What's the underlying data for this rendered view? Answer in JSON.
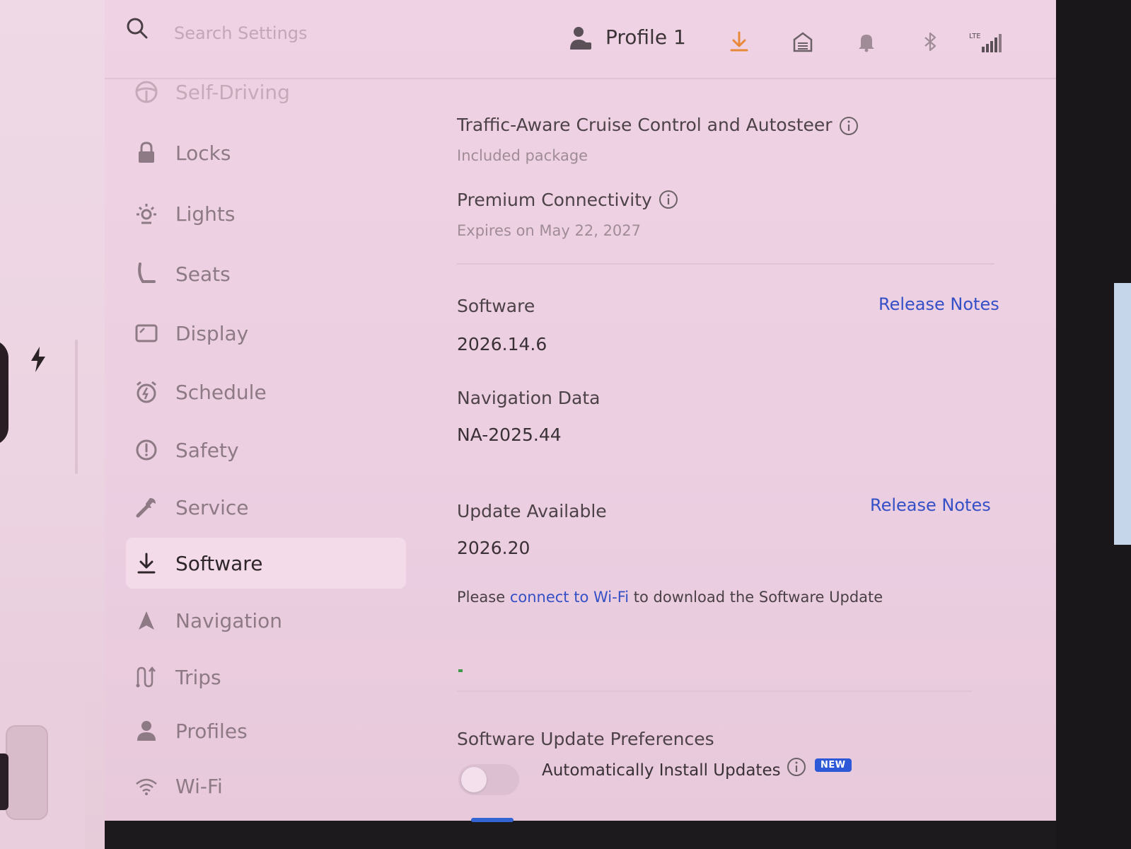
{
  "search": {
    "placeholder": "Search Settings"
  },
  "header": {
    "profile_label": "Profile 1",
    "network_label": "LTE",
    "accent_color": "#e8893a"
  },
  "sidebar": {
    "items": [
      {
        "label": "Self-Driving",
        "icon": "steering-wheel-icon",
        "state": "faded"
      },
      {
        "label": "Locks",
        "icon": "lock-icon",
        "state": "normal"
      },
      {
        "label": "Lights",
        "icon": "light-icon",
        "state": "normal"
      },
      {
        "label": "Seats",
        "icon": "seat-icon",
        "state": "normal"
      },
      {
        "label": "Display",
        "icon": "display-icon",
        "state": "normal"
      },
      {
        "label": "Schedule",
        "icon": "alarm-icon",
        "state": "normal"
      },
      {
        "label": "Safety",
        "icon": "alert-icon",
        "state": "normal"
      },
      {
        "label": "Service",
        "icon": "wrench-icon",
        "state": "normal"
      },
      {
        "label": "Software",
        "icon": "download-icon",
        "state": "active"
      },
      {
        "label": "Navigation",
        "icon": "navigation-arrow-icon",
        "state": "normal"
      },
      {
        "label": "Trips",
        "icon": "trips-icon",
        "state": "normal"
      },
      {
        "label": "Profiles",
        "icon": "person-icon",
        "state": "normal"
      },
      {
        "label": "Wi-Fi",
        "icon": "wifi-icon",
        "state": "normal"
      }
    ]
  },
  "content": {
    "package_title": "Traffic-Aware Cruise Control and Autosteer",
    "package_sub": "Included package",
    "connectivity_title": "Premium Connectivity",
    "connectivity_sub": "Expires on May 22, 2027",
    "software_label": "Software",
    "software_version": "2026.14.6",
    "release_notes_1": "Release Notes",
    "nav_data_label": "Navigation Data",
    "nav_data_version": "NA-2025.44",
    "update_label": "Update Available",
    "update_version": "2026.20",
    "release_notes_2": "Release Notes",
    "wifi_prefix": "Please ",
    "wifi_link": "connect to Wi-Fi",
    "wifi_suffix": " to download the Software Update",
    "prefs_title": "Software Update Preferences",
    "auto_install_label": "Automatically Install Updates",
    "new_badge": "NEW",
    "auto_install_enabled": false
  }
}
